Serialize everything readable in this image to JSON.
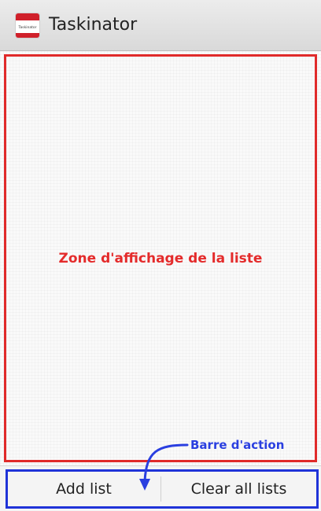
{
  "app_bar": {
    "title": "Taskinator",
    "icon": "notepad-app-icon",
    "icon_text": "Taskinator"
  },
  "list_area": {
    "annotation": "Zone d'affichage de la liste",
    "annotation_color": "#e42b2b"
  },
  "action_bar": {
    "annotation": "Barre d'action",
    "annotation_color": "#2a3fe0",
    "add_list_label": "Add list",
    "clear_all_label": "Clear all lists"
  }
}
